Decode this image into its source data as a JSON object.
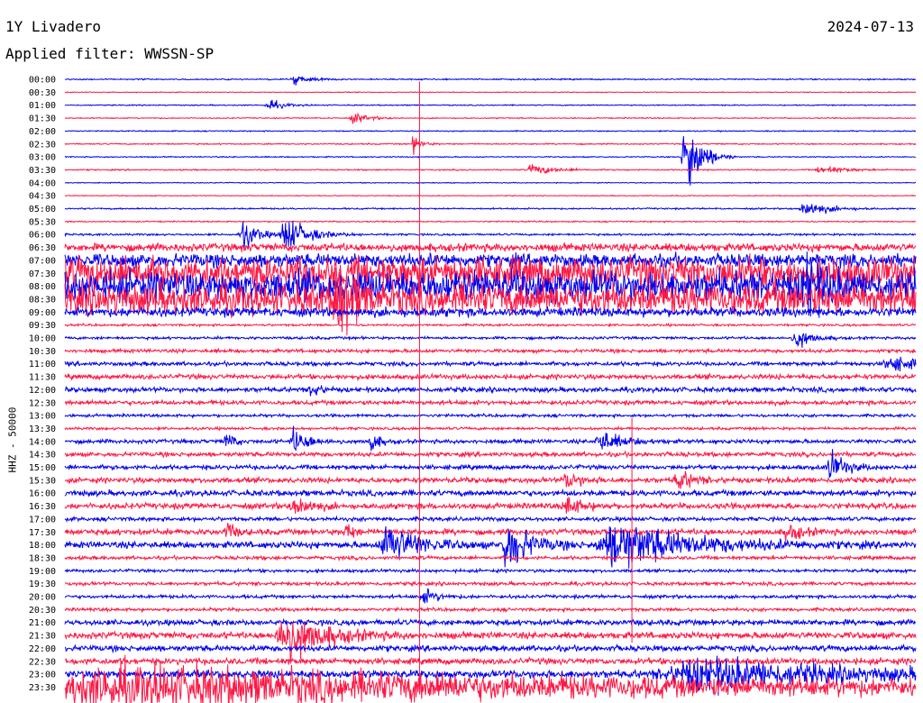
{
  "header": {
    "station": "1Y Livadero",
    "date": "2024-07-13",
    "filter": "Applied filter: WWSSN-SP"
  },
  "chart_data": {
    "type": "line",
    "ylabel": "HHZ - 50000",
    "colors": [
      "#0000ee",
      "#ff1744"
    ],
    "times": [
      "00:00",
      "00:30",
      "01:00",
      "01:30",
      "02:00",
      "02:30",
      "03:00",
      "03:30",
      "04:00",
      "04:30",
      "05:00",
      "05:30",
      "06:00",
      "06:30",
      "07:00",
      "07:30",
      "08:00",
      "08:30",
      "09:00",
      "09:30",
      "10:00",
      "10:30",
      "11:00",
      "11:30",
      "12:00",
      "12:30",
      "13:00",
      "13:30",
      "14:00",
      "14:30",
      "15:00",
      "15:30",
      "16:00",
      "16:30",
      "17:00",
      "17:30",
      "18:00",
      "18:30",
      "19:00",
      "19:30",
      "20:00",
      "20:30",
      "21:00",
      "21:30",
      "22:00",
      "22:30",
      "23:00",
      "23:30"
    ],
    "noise_level": [
      0.6,
      0.4,
      0.5,
      0.5,
      0.5,
      0.6,
      0.5,
      0.6,
      0.4,
      0.4,
      0.7,
      0.6,
      0.9,
      3.5,
      6,
      14,
      14,
      14,
      4,
      1,
      1.2,
      1.6,
      1.8,
      2.2,
      2.2,
      2.0,
      1.3,
      1.2,
      1.8,
      2.0,
      2.0,
      2.4,
      2.6,
      2.6,
      1.8,
      2.6,
      3.0,
      1.6,
      1.4,
      1.6,
      1.5,
      1.5,
      2.5,
      3.0,
      2.6,
      2.8,
      3.5,
      6
    ],
    "events": [
      {
        "t": "00:00",
        "x": 0.27,
        "amp": 5,
        "w": 0.02
      },
      {
        "t": "01:00",
        "x": 0.24,
        "amp": 5,
        "w": 0.02
      },
      {
        "t": "01:30",
        "x": 0.34,
        "amp": 5,
        "w": 0.02
      },
      {
        "t": "02:30",
        "x": 0.41,
        "amp": 9,
        "w": 0.01
      },
      {
        "t": "03:00",
        "x": 0.73,
        "amp": 45,
        "w": 0.02
      },
      {
        "t": "03:30",
        "x": 0.55,
        "amp": 5,
        "w": 0.03
      },
      {
        "t": "03:30",
        "x": 0.89,
        "amp": 4,
        "w": 0.03
      },
      {
        "t": "05:00",
        "x": 0.87,
        "amp": 8,
        "w": 0.03
      },
      {
        "t": "06:00",
        "x": 0.21,
        "amp": 14,
        "w": 0.02
      },
      {
        "t": "06:00",
        "x": 0.26,
        "amp": 18,
        "w": 0.03
      },
      {
        "t": "08:00",
        "x": 0.87,
        "amp": 28,
        "w": 0.02
      },
      {
        "t": "08:30",
        "x": 0.32,
        "amp": 40,
        "w": 0.02
      },
      {
        "t": "10:00",
        "x": 0.86,
        "amp": 10,
        "w": 0.02
      },
      {
        "t": "11:00",
        "x": 0.97,
        "amp": 8,
        "w": 0.03
      },
      {
        "t": "12:00",
        "x": 0.29,
        "amp": 10,
        "w": 0.01
      },
      {
        "t": "14:00",
        "x": 0.19,
        "amp": 10,
        "w": 0.01
      },
      {
        "t": "14:00",
        "x": 0.27,
        "amp": 12,
        "w": 0.02
      },
      {
        "t": "14:00",
        "x": 0.36,
        "amp": 12,
        "w": 0.01
      },
      {
        "t": "14:00",
        "x": 0.63,
        "amp": 10,
        "w": 0.03
      },
      {
        "t": "15:00",
        "x": 0.9,
        "amp": 15,
        "w": 0.02
      },
      {
        "t": "15:30",
        "x": 0.59,
        "amp": 8,
        "w": 0.02
      },
      {
        "t": "15:30",
        "x": 0.72,
        "amp": 10,
        "w": 0.02
      },
      {
        "t": "16:30",
        "x": 0.27,
        "amp": 12,
        "w": 0.02
      },
      {
        "t": "16:30",
        "x": 0.59,
        "amp": 10,
        "w": 0.02
      },
      {
        "t": "17:30",
        "x": 0.19,
        "amp": 12,
        "w": 0.01
      },
      {
        "t": "17:30",
        "x": 0.33,
        "amp": 10,
        "w": 0.01
      },
      {
        "t": "17:30",
        "x": 0.85,
        "amp": 8,
        "w": 0.02
      },
      {
        "t": "18:00",
        "x": 0.38,
        "amp": 20,
        "w": 0.04
      },
      {
        "t": "18:00",
        "x": 0.52,
        "amp": 25,
        "w": 0.03
      },
      {
        "t": "18:00",
        "x": 0.65,
        "amp": 22,
        "w": 0.1
      },
      {
        "t": "20:00",
        "x": 0.42,
        "amp": 8,
        "w": 0.02
      },
      {
        "t": "21:30",
        "x": 0.26,
        "amp": 25,
        "w": 0.05
      },
      {
        "t": "23:00",
        "x": 0.75,
        "amp": 14,
        "w": 0.2
      },
      {
        "t": "23:30",
        "x": 0.08,
        "amp": 16,
        "w": 0.6
      }
    ],
    "spikes": [
      {
        "x": 0.4168,
        "from": "00:30",
        "to": "23:30",
        "amp": 3
      },
      {
        "x": 0.6664,
        "from": "13:30",
        "to": "21:30",
        "amp": 3
      }
    ]
  }
}
